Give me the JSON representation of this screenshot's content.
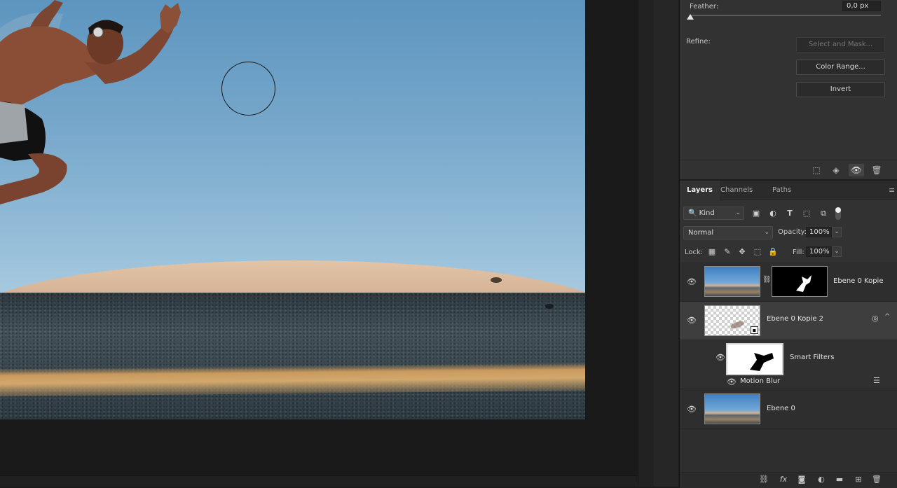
{
  "properties": {
    "feather_label": "Feather:",
    "feather_value": "0,0 px",
    "feather_level": 0,
    "refine_label": "Refine:",
    "buttons": {
      "select_and_mask": "Select and Mask...",
      "color_range": "Color Range...",
      "invert": "Invert"
    },
    "footer_icons": [
      "load-selection-icon",
      "apply-mask-icon",
      "visibility-icon",
      "delete-icon"
    ]
  },
  "layers_panel": {
    "tabs": [
      {
        "label": "Layers",
        "active": true
      },
      {
        "label": "Channels",
        "active": false
      },
      {
        "label": "Paths",
        "active": false
      }
    ],
    "filter_kind": "Kind",
    "blend_mode": "Normal",
    "opacity_label": "Opacity:",
    "opacity_value": "100%",
    "lock_label": "Lock:",
    "fill_label": "Fill:",
    "fill_value": "100%",
    "layers": [
      {
        "name": "Ebene 0 Kopie",
        "visible": true,
        "has_mask": true,
        "selected": false
      },
      {
        "name": "Ebene 0 Kopie 2",
        "visible": true,
        "smart_object": true,
        "selected": true
      },
      {
        "name": "Smart Filters",
        "visible": true,
        "is_filter_mask": true
      },
      {
        "name": "Motion Blur",
        "visible": true,
        "is_filter": true
      },
      {
        "name": "Ebene 0",
        "visible": true,
        "selected": false
      }
    ]
  },
  "colors": {
    "panel_bg": "#323232",
    "workspace_bg": "#1a1a1a",
    "selected_row": "#3e3e3e"
  }
}
